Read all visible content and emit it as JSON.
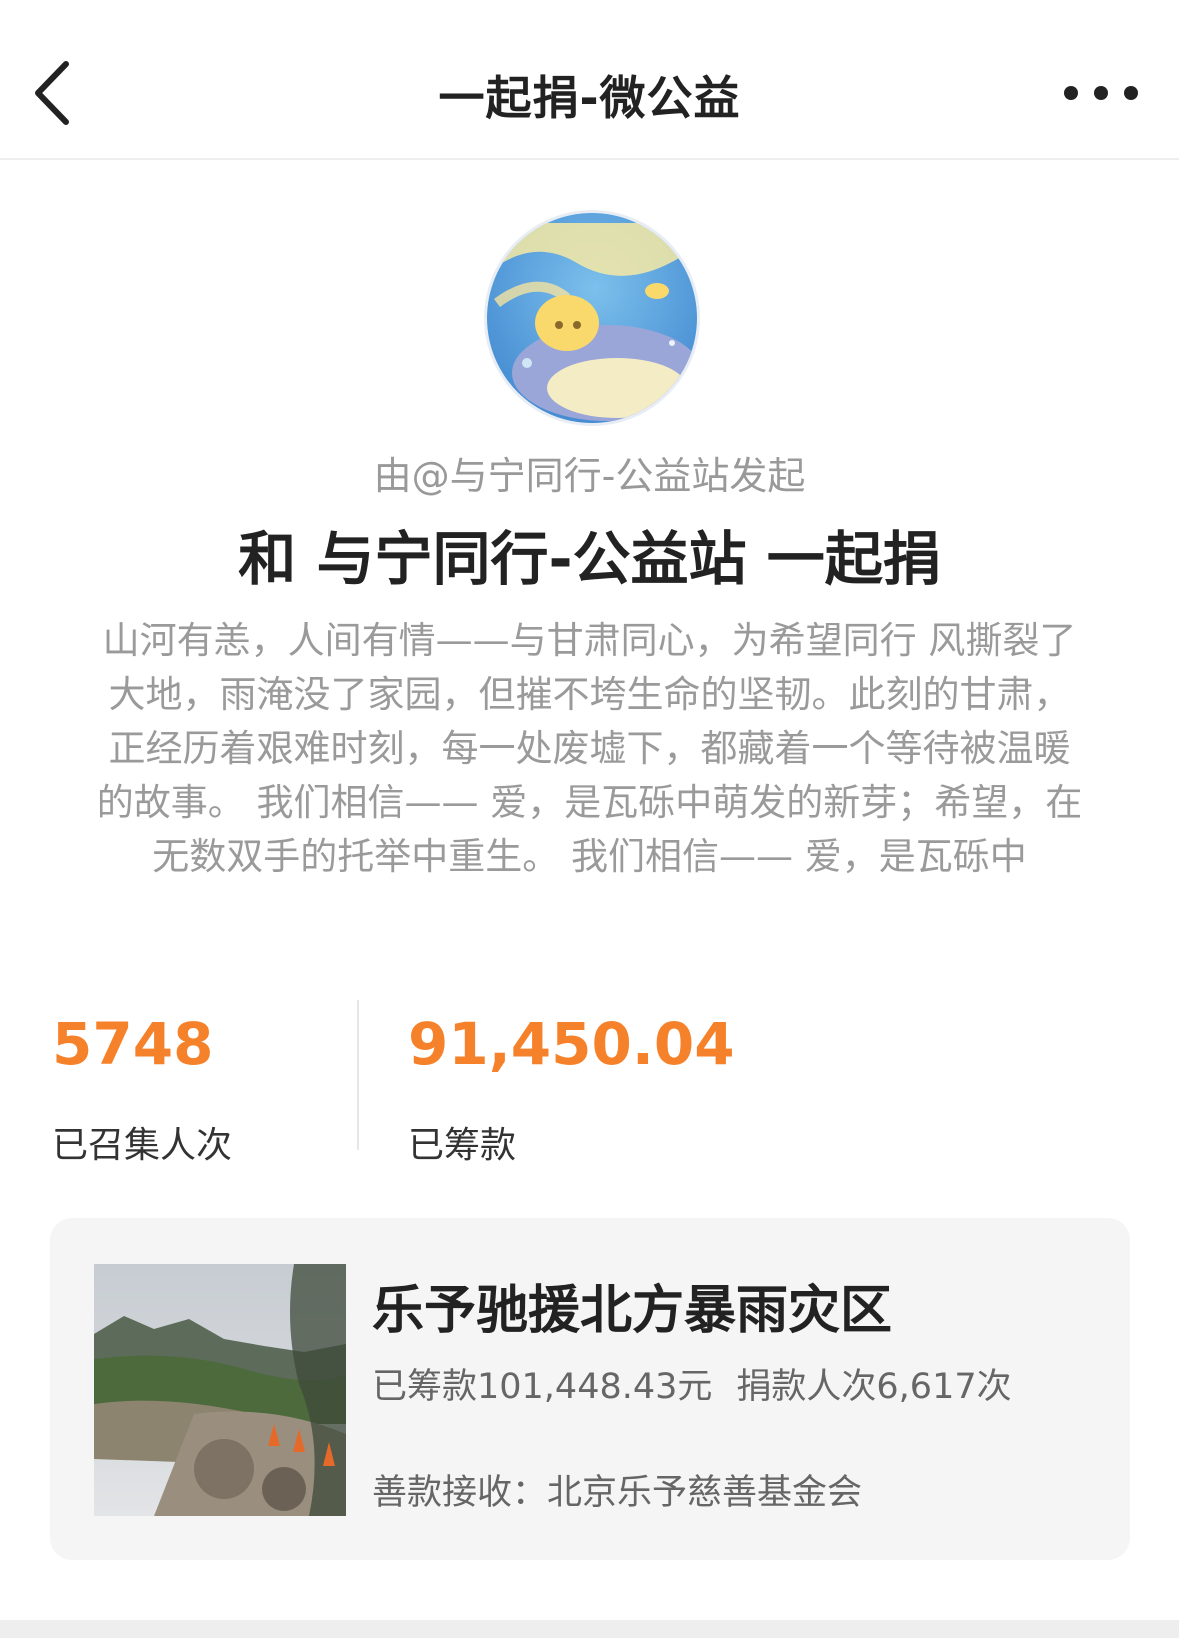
{
  "nav": {
    "title": "一起捐-微公益",
    "back_icon": "chevron-left-icon",
    "more_icon": "more-dots-icon"
  },
  "profile": {
    "avatar_icon": "avatar-illustration",
    "initiator": "由@与宁同行-公益站发起",
    "headline": "和 与宁同行-公益站 一起捐",
    "description": "山河有恙，人间有情——与甘肃同心，为希望同行 风撕裂了大地，雨淹没了家园，但摧不垮生命的坚韧。此刻的甘肃，正经历着艰难时刻，每一处废墟下，都藏着一个等待被温暖的故事。 我们相信—— 爱，是瓦砾中萌发的新芽；希望，在无数双手的托举中重生。 我们相信—— 爱，是瓦砾中"
  },
  "stats": {
    "people_count": "5748",
    "people_label": "已召集人次",
    "amount": "91,450.04",
    "amount_label": "已筹款"
  },
  "project": {
    "title": "乐予驰援北方暴雨灾区",
    "raised": "已筹款101,448.43元",
    "donors": "捐款人次6,617次",
    "receiver": "善款接收：北京乐予慈善基金会"
  },
  "colors": {
    "accent": "#f5822a",
    "card_bg": "#f5f5f5"
  }
}
